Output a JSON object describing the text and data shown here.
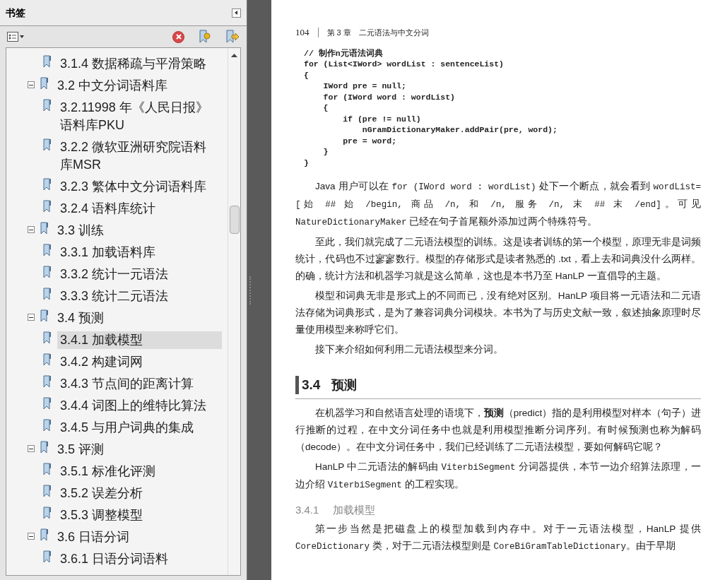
{
  "bookmarks_panel": {
    "title": "书签",
    "tree": [
      {
        "children": [
          {
            "label": "3.1.4 数据稀疏与平滑策略",
            "selected": false
          }
        ]
      },
      {
        "label": "3.2 中文分词语料库",
        "expanded": true,
        "selected": false,
        "children": [
          {
            "label": "3.2.11998 年《人民日报》语料库PKU",
            "selected": false
          },
          {
            "label": "3.2.2 微软亚洲研究院语料库MSR",
            "selected": false
          },
          {
            "label": "3.2.3 繁体中文分词语料库",
            "selected": false
          },
          {
            "label": "3.2.4 语料库统计",
            "selected": false
          }
        ]
      },
      {
        "label": "3.3 训练",
        "expanded": true,
        "selected": false,
        "children": [
          {
            "label": "3.3.1 加载语料库",
            "selected": false
          },
          {
            "label": "3.3.2 统计一元语法",
            "selected": false
          },
          {
            "label": "3.3.3 统计二元语法",
            "selected": false
          }
        ]
      },
      {
        "label": "3.4 预测",
        "expanded": true,
        "selected": false,
        "children": [
          {
            "label": "3.4.1 加载模型",
            "selected": true
          },
          {
            "label": "3.4.2 构建词网",
            "selected": false
          },
          {
            "label": "3.4.3 节点间的距离计算",
            "selected": false
          },
          {
            "label": "3.4.4 词图上的维特比算法",
            "selected": false
          },
          {
            "label": "3.4.5 与用户词典的集成",
            "selected": false
          }
        ]
      },
      {
        "label": "3.5 评测",
        "expanded": true,
        "selected": false,
        "children": [
          {
            "label": "3.5.1 标准化评测",
            "selected": false
          },
          {
            "label": "3.5.2 误差分析",
            "selected": false
          },
          {
            "label": "3.5.3 调整模型",
            "selected": false
          }
        ]
      },
      {
        "label": "3.6 日语分词",
        "expanded": true,
        "selected": false,
        "children": [
          {
            "label": "3.6.1 日语分词语料",
            "selected": false
          }
        ]
      }
    ]
  },
  "page": {
    "page_number": "104",
    "running_head": "第 3 章　二元语法与中文分词",
    "blocks": [
      {
        "kind": "code",
        "lines": [
          "// 制作n元语法词典",
          "for (List<IWord> wordList : sentenceList)",
          "{",
          "    IWord pre = null;",
          "    for (IWord word : wordList)",
          "    {",
          "        if (pre != null)",
          "            nGramDictionaryMaker.addPair(pre, word);",
          "        pre = word;",
          "    }",
          "}"
        ]
      },
      {
        "kind": "para",
        "segments": [
          {
            "kind": "text",
            "text": "Java 用户可以在 "
          },
          {
            "kind": "code",
            "text": "for (IWord word : wordList)"
          },
          {
            "kind": "text",
            "text": " 处下一个断点，就会看到 "
          },
          {
            "kind": "code",
            "text": "wordList=[始 ## 始 /begin, 商品 /n, 和 /n, 服务 /n, 末 ## 末 /end]"
          },
          {
            "kind": "text",
            "text": "。可见 "
          },
          {
            "kind": "code",
            "text": "NatureDictionaryMaker"
          },
          {
            "kind": "text",
            "text": " 已经在句子首尾额外添加过两个特殊符号。"
          }
        ]
      },
      {
        "kind": "para",
        "segments": [
          {
            "kind": "text",
            "text": "至此，我们就完成了二元语法模型的训练。这是读者训练的第一个模型，原理无非是词频统计，代码也不过寥寥数行。模型的存储形式是读者熟悉的 .txt，看上去和词典没什么两样。的确，统计方法和机器学习就是这么简单，这也是本书乃至 HanLP 一直倡导的主题。"
          }
        ]
      },
      {
        "kind": "para",
        "segments": [
          {
            "kind": "text",
            "text": "模型和词典无非是形式上的不同而已，没有绝对区别。HanLP 项目将一元语法和二元语法存储为词典形式，是为了兼容词典分词模块。本书为了与历史文献一致，叙述抽象原理时尽量使用模型来称呼它们。"
          }
        ]
      },
      {
        "kind": "para",
        "segments": [
          {
            "kind": "text",
            "text": "接下来介绍如何利用二元语法模型来分词。"
          }
        ]
      },
      {
        "kind": "section",
        "number": "3.4",
        "title": "预测"
      },
      {
        "kind": "para",
        "segments": [
          {
            "kind": "text",
            "text": "在机器学习和自然语言处理的语境下，**预测**（predict）指的是利用模型对样本（句子）进行推断的过程，在中文分词任务中也就是利用模型推断分词序列。有时候预测也称为解码（decode）。在中文分词任务中，我们已经训练了二元语法模型，要如何解码它呢？"
          }
        ]
      },
      {
        "kind": "para",
        "segments": [
          {
            "kind": "text",
            "text": "HanLP 中二元语法的解码由 "
          },
          {
            "kind": "code",
            "text": "ViterbiSegment"
          },
          {
            "kind": "text",
            "text": " 分词器提供，本节一边介绍算法原理，一边介绍 "
          },
          {
            "kind": "code",
            "text": "ViterbiSegment"
          },
          {
            "kind": "text",
            "text": " 的工程实现。"
          }
        ]
      },
      {
        "kind": "subsection",
        "number": "3.4.1",
        "title": "加载模型"
      },
      {
        "kind": "para",
        "segments": [
          {
            "kind": "text",
            "text": "第一步当然是把磁盘上的模型加载到内存中。对于一元语法模型，HanLP 提供 "
          },
          {
            "kind": "code",
            "text": "CoreDictionary"
          },
          {
            "kind": "text",
            "text": " 类，对于二元语法模型则是 "
          },
          {
            "kind": "code",
            "text": "CoreBiGramTableDictionary"
          },
          {
            "kind": "text",
            "text": "。由于早期"
          }
        ]
      }
    ]
  }
}
